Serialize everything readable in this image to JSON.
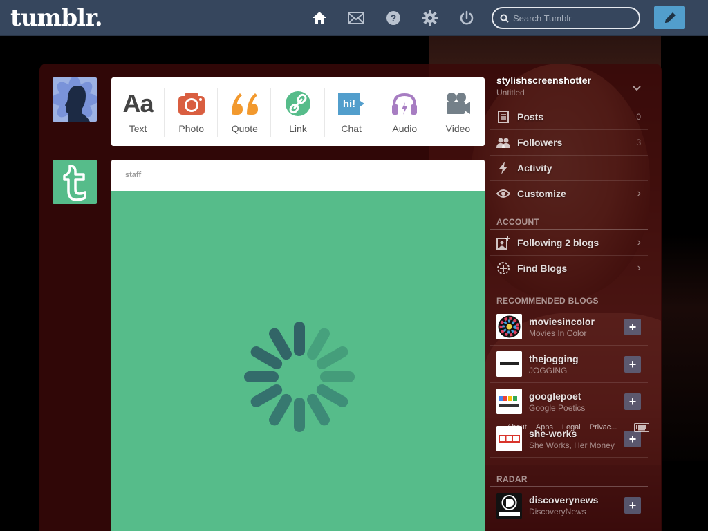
{
  "header": {
    "logo": "tumblr.",
    "search_placeholder": "Search Tumblr"
  },
  "post_types": [
    {
      "label": "Text",
      "glyph": "Aa",
      "color": "#444444"
    },
    {
      "label": "Photo",
      "color": "#d95e40"
    },
    {
      "label": "Quote",
      "color": "#f2992e"
    },
    {
      "label": "Link",
      "color": "#56bc8a"
    },
    {
      "label": "Chat",
      "glyph": "hi!",
      "color": "#529ecc"
    },
    {
      "label": "Audio",
      "color": "#a77dc2"
    },
    {
      "label": "Video",
      "color": "#748089"
    }
  ],
  "post": {
    "author": "staff",
    "body_color": "#56bc8a"
  },
  "sidebar": {
    "blog_name": "stylishscreenshotter",
    "blog_title": "Untitled",
    "items": [
      {
        "label": "Posts",
        "count": "0"
      },
      {
        "label": "Followers",
        "count": "3"
      },
      {
        "label": "Activity"
      },
      {
        "label": "Customize"
      }
    ],
    "account_label": "ACCOUNT",
    "account_items": [
      {
        "label": "Following 2 blogs"
      },
      {
        "label": "Find Blogs"
      }
    ],
    "recommended_label": "RECOMMENDED BLOGS",
    "recommended": [
      {
        "name": "moviesincolor",
        "sub": "Movies In Color"
      },
      {
        "name": "thejogging",
        "sub": "JOGGING"
      },
      {
        "name": "googlepoet",
        "sub": "Google Poetics"
      },
      {
        "name": "she-works",
        "sub": "She Works, Her Money"
      }
    ],
    "radar_label": "RADAR",
    "radar": [
      {
        "name": "discoverynews",
        "sub": "DiscoveryNews"
      }
    ]
  },
  "footer": {
    "links": [
      "About",
      "Apps",
      "Legal",
      "Privac..."
    ]
  },
  "colors": {
    "nav_bg": "#36465d",
    "compose": "#529ecc",
    "staff_green": "#56bc8a"
  }
}
